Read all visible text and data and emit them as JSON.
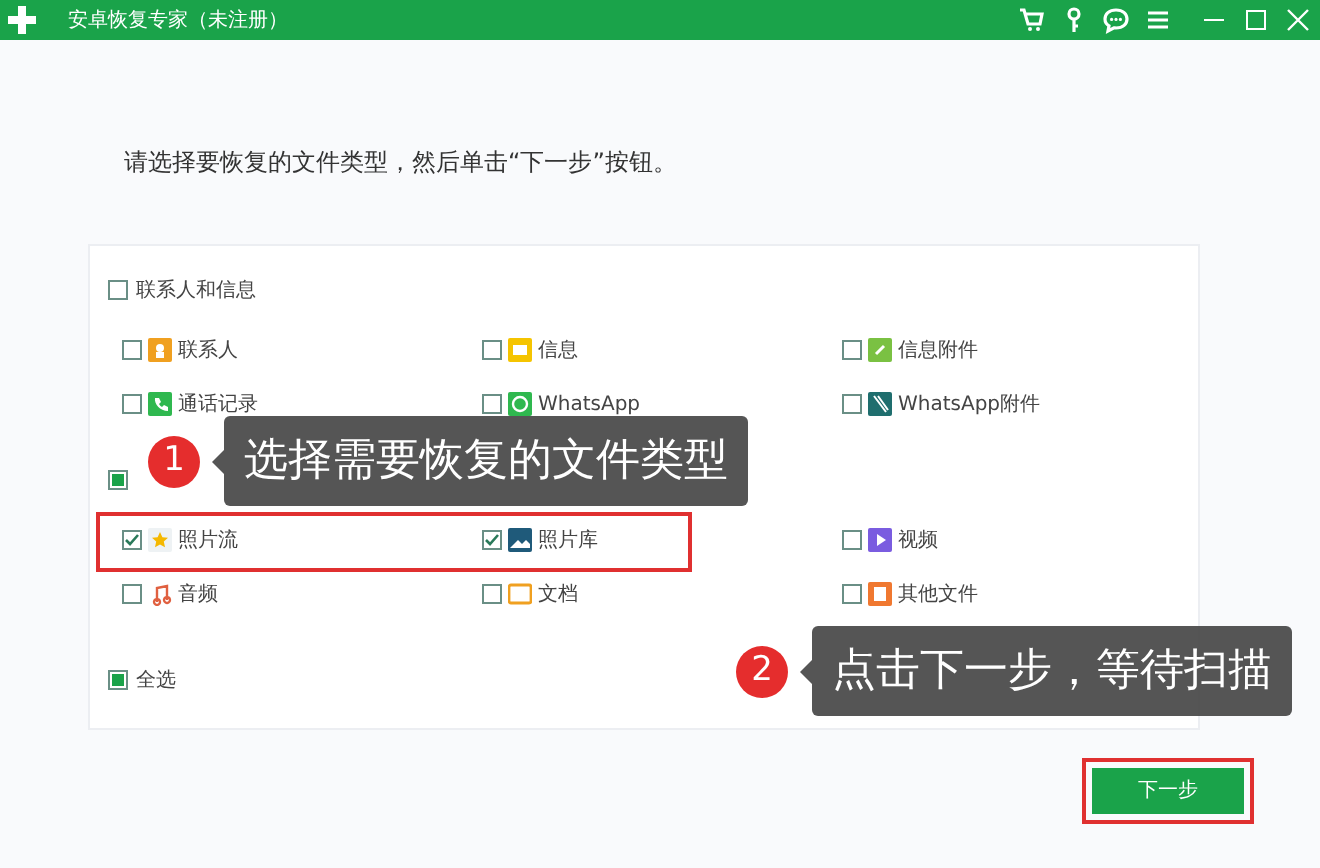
{
  "window": {
    "title": "安卓恢复专家（未注册）"
  },
  "instruction": "请选择要恢复的文件类型，然后单击“下一步”按钮。",
  "groups": [
    {
      "label": "联系人和信息",
      "checked": false,
      "indeterminate": false,
      "items": [
        {
          "label": "联系人",
          "checked": false,
          "highlighted": false
        },
        {
          "label": "信息",
          "checked": false,
          "highlighted": false
        },
        {
          "label": "信息附件",
          "checked": false,
          "highlighted": false
        },
        {
          "label": "通话记录",
          "checked": false,
          "highlighted": false
        },
        {
          "label": "WhatsApp",
          "checked": false,
          "highlighted": false
        },
        {
          "label": "WhatsApp附件",
          "checked": false,
          "highlighted": false
        }
      ]
    },
    {
      "checked": false,
      "indeterminate": true,
      "items": [
        {
          "label": "照片流",
          "checked": true,
          "highlighted": true
        },
        {
          "label": "照片库",
          "checked": true,
          "highlighted": true
        },
        {
          "label": "视频",
          "checked": false,
          "highlighted": false
        },
        {
          "label": "音频",
          "checked": false,
          "highlighted": false
        },
        {
          "label": "文档",
          "checked": false,
          "highlighted": false
        },
        {
          "label": "其他文件",
          "checked": false,
          "highlighted": false
        }
      ]
    }
  ],
  "select_all": {
    "label": "全选",
    "checked": false,
    "indeterminate": true
  },
  "next_button": {
    "label": "下一步",
    "highlighted": true
  },
  "callouts": [
    {
      "number": "1",
      "text": "选择需要恢复的文件类型"
    },
    {
      "number": "2",
      "text": "点击下一步，等待扫描"
    }
  ]
}
